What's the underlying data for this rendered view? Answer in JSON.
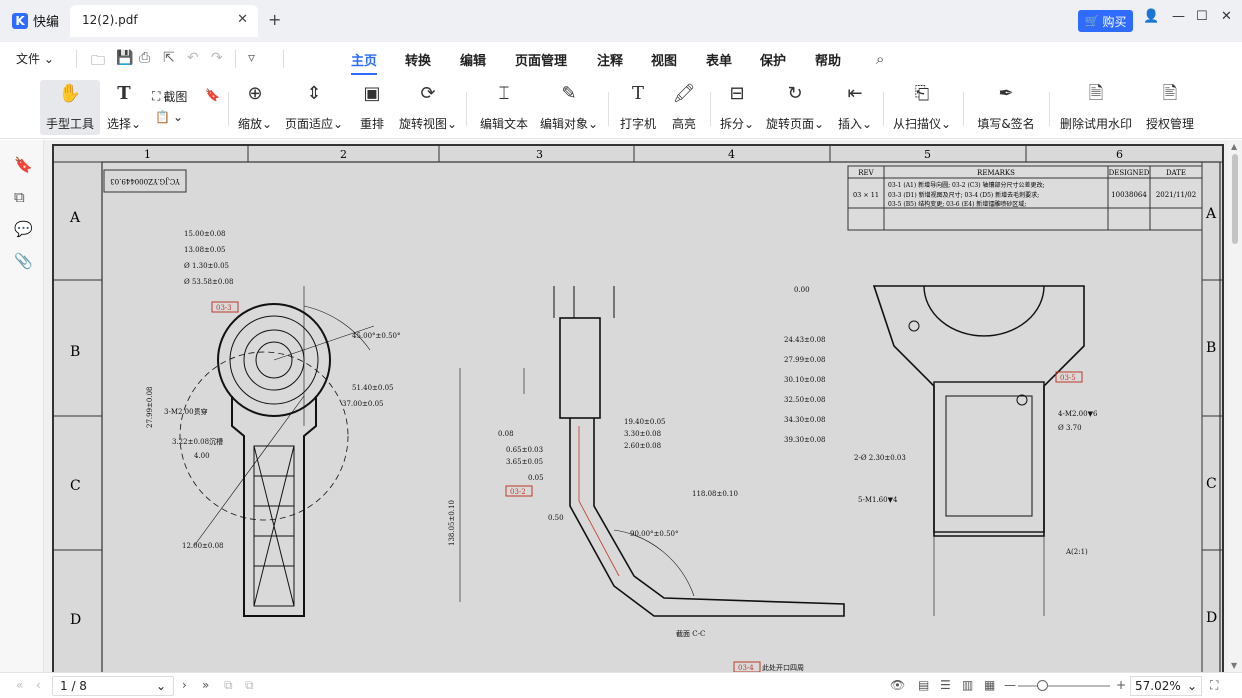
{
  "app": {
    "name": "快编",
    "logo_letter": "K",
    "accent": "#2f6bff"
  },
  "tab": {
    "title": "12(2).pdf",
    "close": "✕",
    "new": "+"
  },
  "buy_label": "购买",
  "window": {
    "min": "—",
    "max": "☐",
    "close": "✕"
  },
  "menu": {
    "file_label": "文件",
    "tabs": [
      "主页",
      "转换",
      "编辑",
      "页面管理",
      "注释",
      "视图",
      "表单",
      "保护",
      "帮助"
    ],
    "active_tab": "主页"
  },
  "ribbon": {
    "hand": "手型工具",
    "select": "选择",
    "screenshot": "截图",
    "zoom": "缩放",
    "page_fit": "页面适应",
    "reflow": "重排",
    "rotate_view": "旋转视图",
    "edit_text": "编辑文本",
    "edit_object": "编辑对象",
    "typewriter": "打字机",
    "highlight": "高亮",
    "split": "拆分",
    "rotate_page": "旋转页面",
    "insert": "插入",
    "from_scanner": "从扫描仪",
    "fill_sign": "填写&签名",
    "remove_watermark": "删除试用水印",
    "license": "授权管理"
  },
  "status": {
    "page_current": "1 / 8",
    "zoom": "57.02%"
  },
  "drawing": {
    "col_labels": [
      "1",
      "2",
      "3",
      "4",
      "5",
      "6"
    ],
    "row_labels": [
      "A",
      "B",
      "C",
      "D"
    ],
    "drawing_no": "YC.JG.YZ000449.03",
    "rev_table": {
      "headers": [
        "REV",
        "REMARKS",
        "DESIGNED",
        "DATE"
      ],
      "rev": "03 × 11",
      "remarks": [
        "03-1 (A1) 新增导向圆; 03-2 (C3) 轴镶部分尺寸公差更改;",
        "03-3 (D1) 新增视图及尺寸; 03-4 (D5) 新增去毛刺要求;",
        "03-5 (B5) 结构变更; 03-6 (E4) 新增镭雕喷砂区域;"
      ],
      "designed": "10038064",
      "date": "2021/11/02"
    },
    "dims_left": [
      "15.00±0.08",
      "13.08±0.05",
      "Ø 1.30±0.05",
      "Ø 53.58±0.08",
      "3-M2.00贯穿",
      "3.22±0.08沉槽",
      "4.00",
      "12.00±0.08",
      "27.99±0.08",
      "45.00°±0.50°",
      "51.40±0.05",
      "37.00±0.05"
    ],
    "dims_mid": [
      "19.40±0.05",
      "3.30±0.08",
      "2.60±0.08",
      "0.65±0.03",
      "3.65±0.05",
      "0.05",
      "0.08",
      "0.50",
      "118.08±0.10",
      "90.00°±0.50°",
      "138.05±0.10",
      "截面 C-C"
    ],
    "dims_right": [
      "24.43±0.08",
      "27.99±0.08",
      "30.10±0.08",
      "32.50±0.08",
      "34.30±0.08",
      "39.30±0.08",
      "2-Ø 2.30±0.03",
      "5-M1.60▼4",
      "4-M2.00▼6",
      "Ø 3.70",
      "0.00",
      "A(2:1)"
    ],
    "revision_tags": [
      "03-3",
      "03-2",
      "03-5",
      "03-4"
    ],
    "note_bottom": "此处开口四周"
  }
}
